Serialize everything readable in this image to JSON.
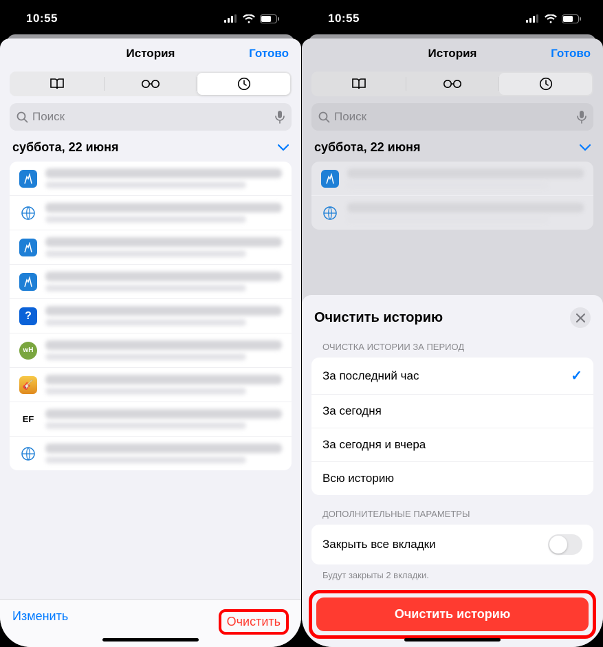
{
  "status": {
    "time": "10:55"
  },
  "nav": {
    "title": "История",
    "done": "Готово"
  },
  "search": {
    "placeholder": "Поиск"
  },
  "date_header": "суббота, 22 июня",
  "toolbar": {
    "edit": "Изменить",
    "clear": "Очистить"
  },
  "action_sheet": {
    "title": "Очистить историю",
    "section1_label": "ОЧИСТКА ИСТОРИИ ЗА ПЕРИОД",
    "options": {
      "last_hour": "За последний час",
      "today": "За сегодня",
      "today_yesterday": "За сегодня и вчера",
      "all": "Всю историю"
    },
    "section2_label": "ДОПОЛНИТЕЛЬНЫЕ ПАРАМЕТРЫ",
    "close_tabs_label": "Закрыть все вкладки",
    "close_tabs_hint": "Будут закрыты 2 вкладки.",
    "confirm_button": "Очистить историю"
  }
}
